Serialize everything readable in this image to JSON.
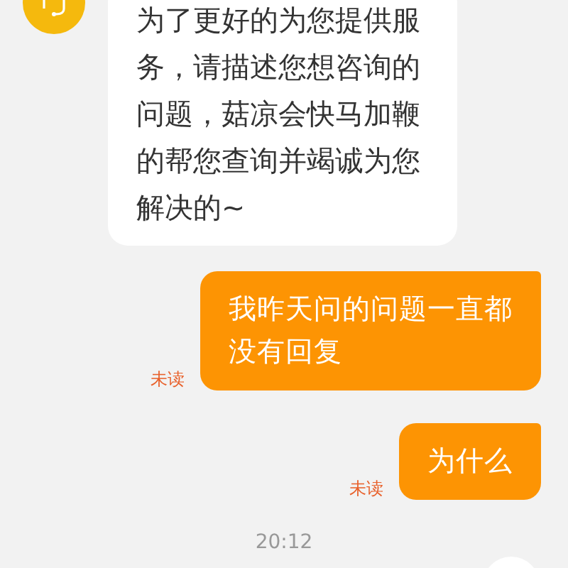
{
  "messages": [
    {
      "kind": "agent",
      "text": "为了更好的为您提供服务，请描述您想咨询的问题，菇凉会快马加鞭的帮您查询并竭诚为您解决的~"
    },
    {
      "kind": "user",
      "text": "我昨天问的问题一直都没有回复",
      "status": "未读"
    },
    {
      "kind": "user",
      "text": "为什么",
      "status": "未读"
    }
  ],
  "timestamp": "20:12"
}
